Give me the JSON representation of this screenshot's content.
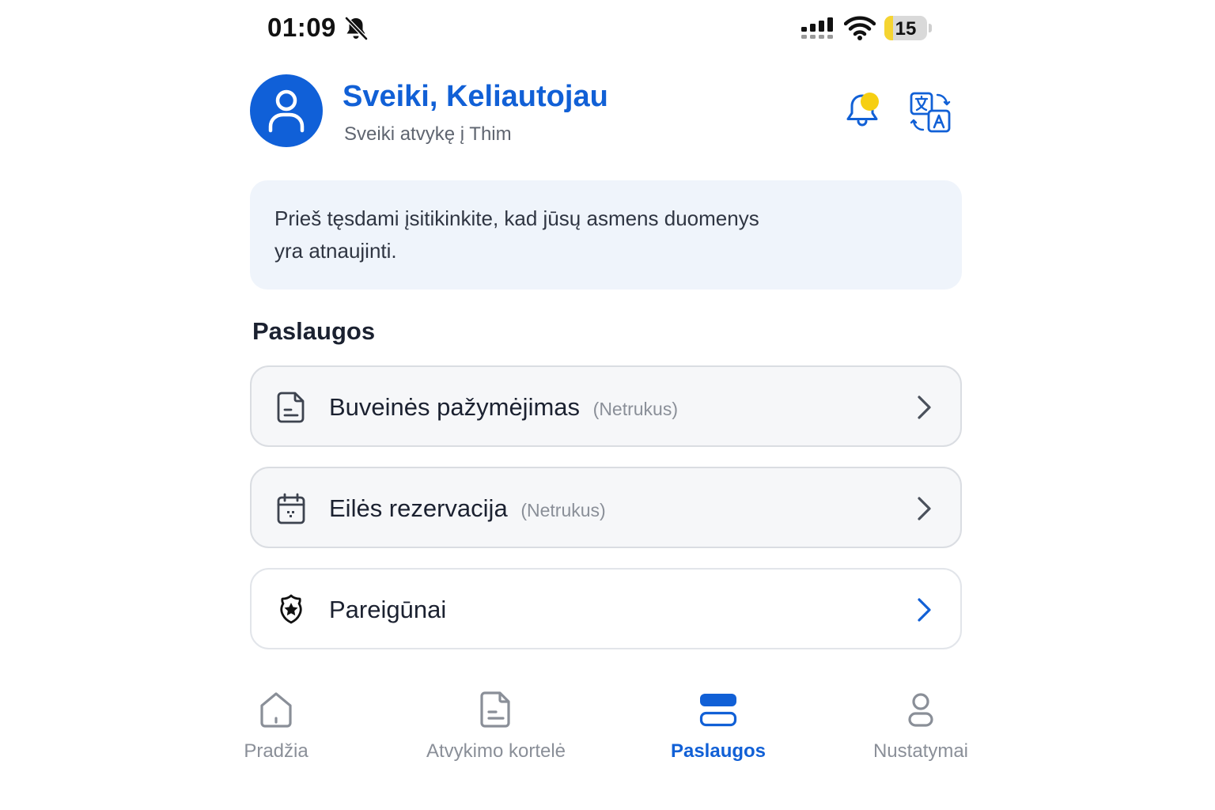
{
  "status_bar": {
    "time": "01:09",
    "battery_level": "15",
    "icons": [
      "bell-off-icon",
      "signal-icon",
      "wifi-icon",
      "battery-icon"
    ]
  },
  "header": {
    "greeting": "Sveiki, Keliautojau",
    "subtitle": "Sveiki atvykę į Thim",
    "notification_dot_color": "#f6cf12"
  },
  "banner": {
    "text_line1": "Prieš tęsdami įsitikinkite, kad jūsų asmens duomenys",
    "text_line2": "yra atnaujinti."
  },
  "services": {
    "title": "Paslaugos",
    "items": [
      {
        "label": "Buveinės pažymėjimas",
        "note": "(Netrukus)",
        "icon": "document-icon",
        "enabled": false
      },
      {
        "label": "Eilės rezervacija",
        "note": "(Netrukus)",
        "icon": "calendar-icon",
        "enabled": false
      },
      {
        "label": "Pareigūnai",
        "note": "",
        "icon": "police-badge-icon",
        "enabled": true
      }
    ]
  },
  "bottom_nav": {
    "items": [
      {
        "label": "Pradžia",
        "icon": "home-icon",
        "active": false
      },
      {
        "label": "Atvykimo kortelė",
        "icon": "card-document-icon",
        "active": false
      },
      {
        "label": "Paslaugos",
        "icon": "services-icon",
        "active": true
      },
      {
        "label": "Nustatymai",
        "icon": "profile-icon",
        "active": false
      }
    ]
  },
  "colors": {
    "accent": "#1160d6",
    "muted": "#8a8f98",
    "banner_bg": "#eff4fb"
  }
}
